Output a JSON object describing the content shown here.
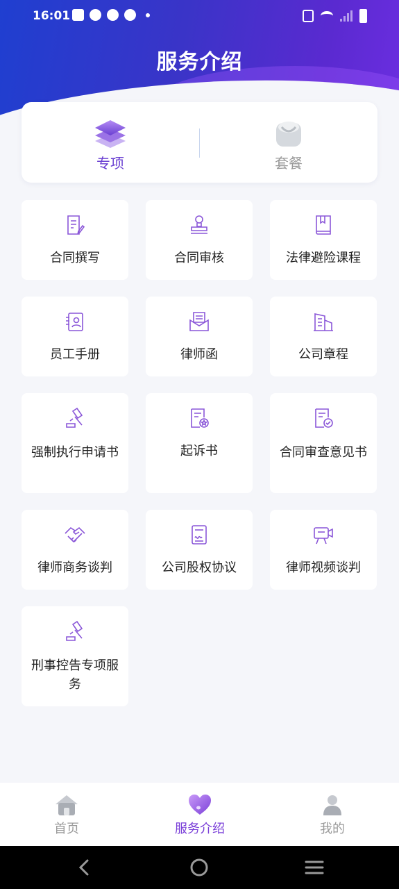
{
  "status_bar": {
    "time": "16:01"
  },
  "header": {
    "title": "服务介绍"
  },
  "tabs": [
    {
      "label": "专项",
      "icon": "layers-icon",
      "active": true
    },
    {
      "label": "套餐",
      "icon": "package-bag-icon",
      "active": false
    }
  ],
  "services": [
    {
      "label": "合同撰写",
      "icon": "document-edit-icon"
    },
    {
      "label": "合同审核",
      "icon": "stamp-icon"
    },
    {
      "label": "法律避险课程",
      "icon": "book-icon"
    },
    {
      "label": "员工手册",
      "icon": "id-card-icon"
    },
    {
      "label": "律师函",
      "icon": "letter-icon"
    },
    {
      "label": "公司章程",
      "icon": "building-icon"
    },
    {
      "label": "强制执行申请书",
      "icon": "gavel-icon"
    },
    {
      "label": "起诉书",
      "icon": "document-star-icon"
    },
    {
      "label": "合同审查意见书",
      "icon": "document-check-icon"
    },
    {
      "label": "律师商务谈判",
      "icon": "handshake-icon"
    },
    {
      "label": "公司股权协议",
      "icon": "contract-signature-icon"
    },
    {
      "label": "律师视频谈判",
      "icon": "video-call-icon"
    },
    {
      "label": "刑事控告专项服务",
      "icon": "gavel-icon"
    }
  ],
  "bottom_nav": [
    {
      "label": "首页",
      "icon": "home-icon",
      "active": false
    },
    {
      "label": "服务介绍",
      "icon": "heart-icon",
      "active": true
    },
    {
      "label": "我的",
      "icon": "user-icon",
      "active": false
    }
  ],
  "colors": {
    "accent": "#6a3fd2",
    "icon_stroke": "#8a56d8",
    "header_start": "#1f3fd0",
    "header_end": "#6b2ee0"
  }
}
